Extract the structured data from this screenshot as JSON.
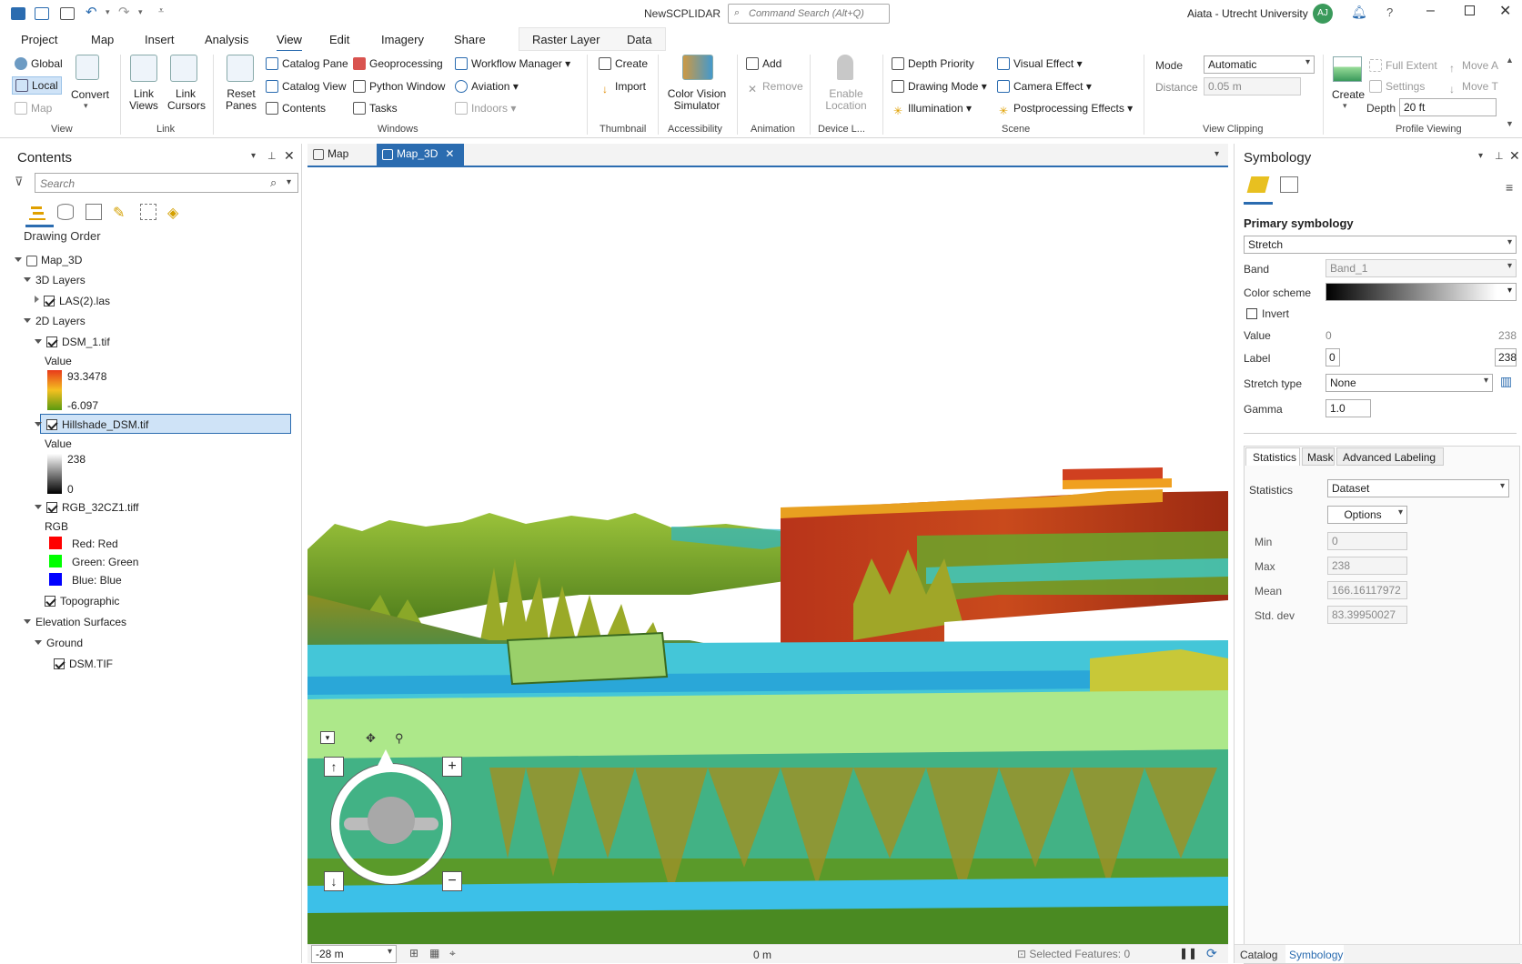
{
  "window": {
    "title": "NewSCPLIDAR",
    "search_placeholder": "Command Search (Alt+Q)",
    "user": "Aiata - Utrecht University",
    "avatar": "AJ"
  },
  "tabs": [
    "Project",
    "Map",
    "Insert",
    "Analysis",
    "View",
    "Edit",
    "Imagery",
    "Share",
    "Raster Layer",
    "Data"
  ],
  "active_tab": "View",
  "ribbon": {
    "view": {
      "global": "Global",
      "local": "Local",
      "map": "Map",
      "convert": "Convert",
      "label": "View"
    },
    "link": {
      "link_views": "Link Views",
      "link_cursors": "Link Cursors",
      "label": "Link"
    },
    "windows": {
      "reset_panes": "Reset Panes",
      "catalog_pane": "Catalog Pane",
      "catalog_view": "Catalog View",
      "contents": "Contents",
      "geoprocessing": "Geoprocessing",
      "python_window": "Python Window",
      "tasks": "Tasks",
      "workflow_manager": "Workflow Manager",
      "aviation": "Aviation",
      "indoors": "Indoors",
      "label": "Windows"
    },
    "thumbnail": {
      "create": "Create",
      "import": "Import",
      "label": "Thumbnail"
    },
    "accessibility": {
      "cvs": "Color Vision Simulator",
      "label": "Accessibility"
    },
    "animation": {
      "add": "Add",
      "remove": "Remove",
      "label": "Animation"
    },
    "device": {
      "enable_location": "Enable Location",
      "label": "Device L..."
    },
    "scene": {
      "depth_priority": "Depth Priority",
      "drawing_mode": "Drawing Mode",
      "illumination": "Illumination",
      "visual_effect": "Visual Effect",
      "camera_effect": "Camera Effect",
      "postprocessing": "Postprocessing Effects",
      "label": "Scene"
    },
    "clipping": {
      "mode_label": "Mode",
      "mode_value": "Automatic",
      "distance_label": "Distance",
      "distance_value": "0.05  m",
      "label": "View Clipping"
    },
    "profile": {
      "create": "Create",
      "full_extent": "Full Extent",
      "settings": "Settings",
      "move_a": "Move A",
      "move_t": "Move T",
      "depth_label": "Depth",
      "depth_value": "20 ft",
      "label": "Profile Viewing"
    }
  },
  "contents": {
    "title": "Contents",
    "search_placeholder": "Search",
    "drawing_order": "Drawing Order",
    "map": "Map_3D",
    "layers3d": "3D Layers",
    "las": "LAS(2).las",
    "layers2d": "2D Layers",
    "dsm": "DSM_1.tif",
    "value": "Value",
    "dsm_max": "93.3478",
    "dsm_min": "-6.097",
    "hillshade": "Hillshade_DSM.tif",
    "hs_max": "238",
    "hs_min": "0",
    "rgb_layer": "RGB_32CZ1.tiff",
    "rgb": "RGB",
    "red": "Red:   Red",
    "green": "Green:  Green",
    "blue": "Blue:   Blue",
    "topographic": "Topographic",
    "elev": "Elevation Surfaces",
    "ground": "Ground",
    "dsm_tif": "DSM.TIF"
  },
  "mapview": {
    "tab_map": "Map",
    "tab_map3d": "Map_3D",
    "scale": "-28 m",
    "coord": "0 m",
    "selected": "Selected Features: 0"
  },
  "symbology": {
    "title": "Symbology",
    "primary": "Primary symbology",
    "renderer": "Stretch",
    "band_label": "Band",
    "band_value": "Band_1",
    "scheme_label": "Color scheme",
    "invert": "Invert",
    "value_label": "Value",
    "value_min": "0",
    "value_max": "238",
    "label_label": "Label",
    "label_min": "0",
    "label_max": "238",
    "stretch_label": "Stretch type",
    "stretch_value": "None",
    "gamma_label": "Gamma",
    "gamma_value": "1.0",
    "tabs": [
      "Statistics",
      "Mask",
      "Advanced Labeling"
    ],
    "stats_label": "Statistics",
    "stats_value": "Dataset",
    "options": "Options",
    "min_label": "Min",
    "min": "0",
    "max_label": "Max",
    "max": "238",
    "mean_label": "Mean",
    "mean": "166.16117972",
    "std_label": "Std. dev",
    "std": "83.39950027",
    "bottom_tabs": [
      "Catalog",
      "Symbology"
    ]
  },
  "colors": {
    "accent": "#2b6cb0",
    "selection": "#cfe3f7"
  }
}
